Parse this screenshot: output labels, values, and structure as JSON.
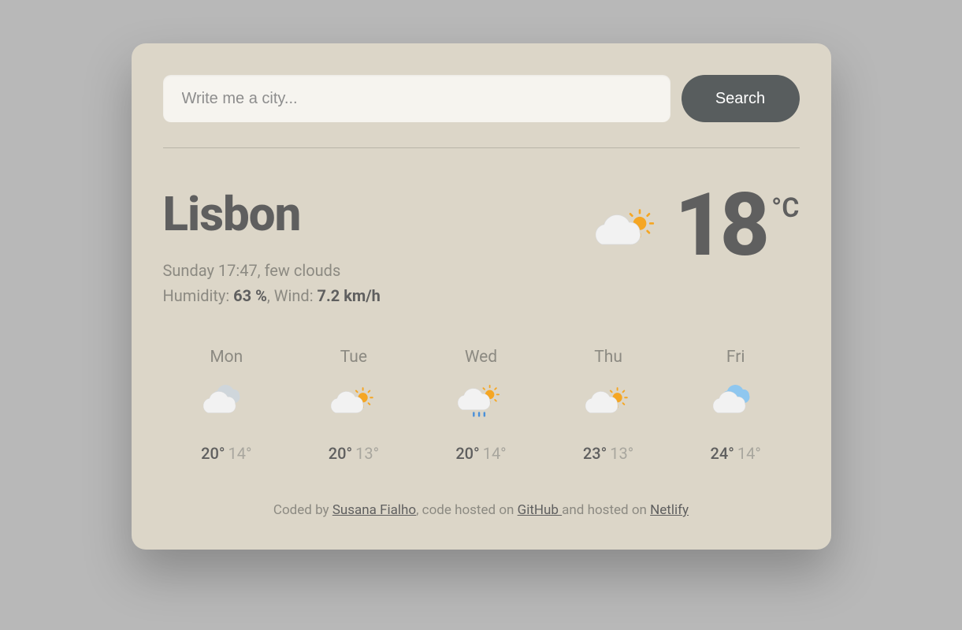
{
  "search": {
    "placeholder": "Write me a city...",
    "button": "Search"
  },
  "current": {
    "city": "Lisbon",
    "datetime_desc": "Sunday 17:47, few clouds",
    "humidity_label": "Humidity: ",
    "humidity_value": "63 %",
    "wind_sep": ", Wind: ",
    "wind_value": "7.2 km/h",
    "temp": "18",
    "unit": "°C",
    "icon": "partly-cloudy"
  },
  "forecast": [
    {
      "day": "Mon",
      "hi": "20°",
      "lo": "14°",
      "icon": "cloudy"
    },
    {
      "day": "Tue",
      "hi": "20°",
      "lo": "13°",
      "icon": "partly-cloudy"
    },
    {
      "day": "Wed",
      "hi": "20°",
      "lo": "14°",
      "icon": "rain-sun"
    },
    {
      "day": "Thu",
      "hi": "23°",
      "lo": "13°",
      "icon": "partly-cloudy"
    },
    {
      "day": "Fri",
      "hi": "24°",
      "lo": "14°",
      "icon": "cloudy-blue"
    }
  ],
  "footer": {
    "coded_by": "Coded by ",
    "author": "Susana Fialho",
    "sep1": ", code hosted on ",
    "github": "GitHub ",
    "sep2": "and hosted on ",
    "netlify": "Netlify"
  }
}
